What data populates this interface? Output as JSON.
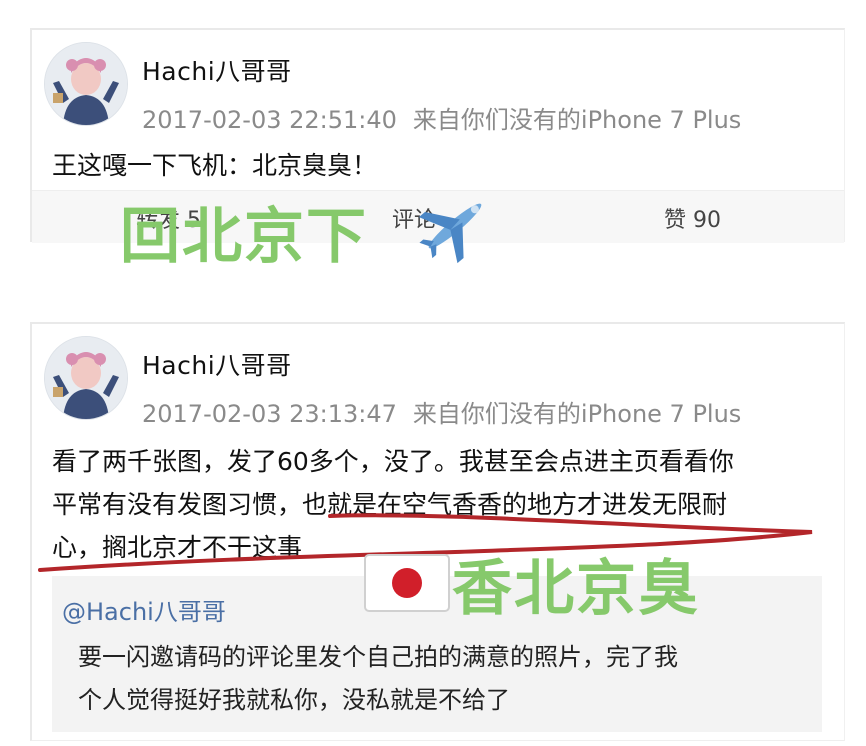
{
  "post1": {
    "username": "Hachi八哥哥",
    "timestamp": "2017-02-03 22:51:40",
    "source": "来自你们没有的iPhone 7 Plus",
    "text": "王这嘎一下飞机：北京臭臭！",
    "actions": {
      "repost_label": "转发 5",
      "comment_label": "评论",
      "like_label": "赞 90"
    }
  },
  "overlay1": {
    "text": "回北京下",
    "emoji": "airplane-emoji",
    "color": "#86c96b"
  },
  "post2": {
    "username": "Hachi八哥哥",
    "timestamp": "2017-02-03 23:13:47",
    "source": "来自你们没有的iPhone 7 Plus",
    "lines": [
      "看了两千张图，发了60多个，没了。我甚至会点进主页看看你",
      "平常有没有发图习惯，也就是在空气香香的地方才进发无限耐",
      "心，搁北京才不干这事"
    ],
    "quote": {
      "mention": "@Hachi八哥哥",
      "lines": [
        "要一闪邀请码的评论里发个自己拍的满意的照片，完了我",
        "个人觉得挺好我就私你，没私就是不给了"
      ]
    }
  },
  "overlay2": {
    "text": "香北京臭",
    "emoji": "japan-flag-emoji",
    "color": "#86c96b"
  },
  "colors": {
    "annotation_underline": "#b3262a",
    "overlay_green": "#86c96b",
    "mention_blue": "#4a6fa5",
    "meta_gray": "#8a8a8a"
  }
}
